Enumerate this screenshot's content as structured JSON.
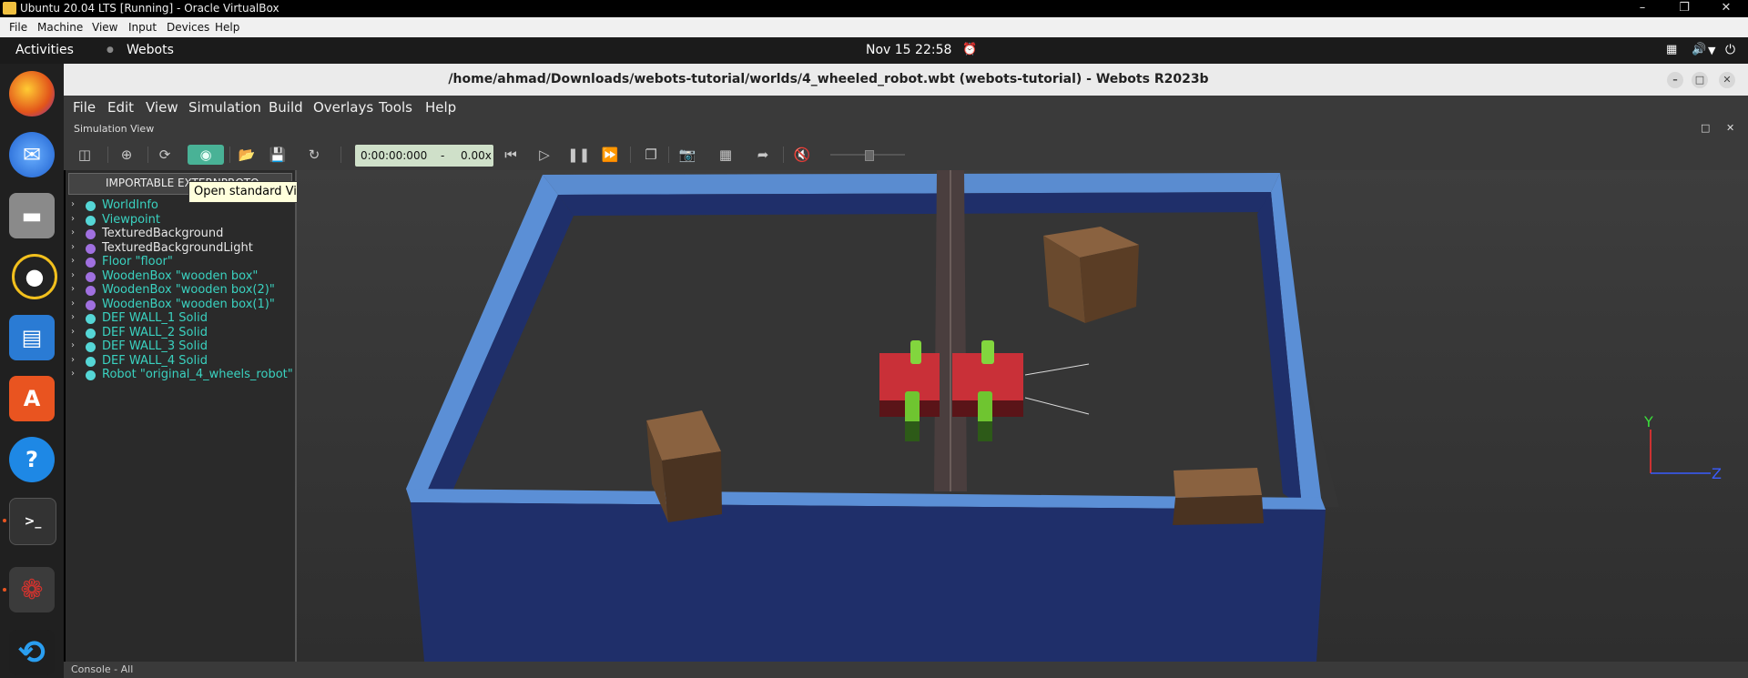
{
  "vbox": {
    "title": "Ubuntu 20.04 LTS [Running] - Oracle VirtualBox",
    "menu": [
      "File",
      "Machine",
      "View",
      "Input",
      "Devices",
      "Help"
    ]
  },
  "gnome": {
    "activities": "Activities",
    "app_name": "Webots",
    "datetime": "Nov 15  22:58"
  },
  "dock": {
    "apps": [
      "firefox-icon",
      "thunderbird-icon",
      "files-icon",
      "rhythmbox-icon",
      "libreoffice-impress-icon",
      "software-center-icon",
      "help-icon",
      "terminal-icon",
      "webots-icon",
      "vscode-icon"
    ]
  },
  "webots": {
    "title": "/home/ahmad/Downloads/webots-tutorial/worlds/4_wheeled_robot.wbt (webots-tutorial) - Webots R2023b",
    "menu": [
      "File",
      "Edit",
      "View",
      "Simulation",
      "Build",
      "Overlays",
      "Tools",
      "Help"
    ],
    "panel_label": "Simulation View",
    "time": "0:00:00:000",
    "time_sep": "-",
    "speed": "0.00x",
    "tooltip": "Open standard Viewpoint positions menu.",
    "tree_header": "IMPORTABLE EXTERNPROTO",
    "tree": [
      {
        "label": "WorldInfo",
        "color": "#3ad2c0",
        "dot": "#55d6d6"
      },
      {
        "label": "Viewpoint",
        "color": "#3ad2c0",
        "dot": "#55d6d6"
      },
      {
        "label": "TexturedBackground",
        "color": "#e6e6e6",
        "dot": "#a070e0"
      },
      {
        "label": "TexturedBackgroundLight",
        "color": "#e6e6e6",
        "dot": "#a070e0"
      },
      {
        "label": "Floor \"floor\"",
        "color": "#3ad2c0",
        "dot": "#a070e0"
      },
      {
        "label": "WoodenBox \"wooden box\"",
        "color": "#3ad2c0",
        "dot": "#a070e0"
      },
      {
        "label": "WoodenBox \"wooden box(2)\"",
        "color": "#3ad2c0",
        "dot": "#a070e0"
      },
      {
        "label": "WoodenBox \"wooden box(1)\"",
        "color": "#3ad2c0",
        "dot": "#a070e0"
      },
      {
        "label": "DEF WALL_1 Solid",
        "color": "#3ad2c0",
        "dot": "#55d6d6"
      },
      {
        "label": "DEF WALL_2 Solid",
        "color": "#3ad2c0",
        "dot": "#55d6d6"
      },
      {
        "label": "DEF WALL_3 Solid",
        "color": "#3ad2c0",
        "dot": "#55d6d6"
      },
      {
        "label": "DEF WALL_4 Solid",
        "color": "#3ad2c0",
        "dot": "#55d6d6"
      },
      {
        "label": "Robot \"original_4_wheels_robot\"",
        "color": "#3ad2c0",
        "dot": "#55d6d6"
      }
    ],
    "axis_labels": {
      "y": "Y",
      "z": "Z"
    },
    "console_label": "Console - All"
  },
  "colors": {
    "wall_outer": "#4f7fc4",
    "wall_inner": "#1d2f6a",
    "robot_body": "#c8323a",
    "wheel": "#7ad13a",
    "wood": "#7a5534"
  }
}
